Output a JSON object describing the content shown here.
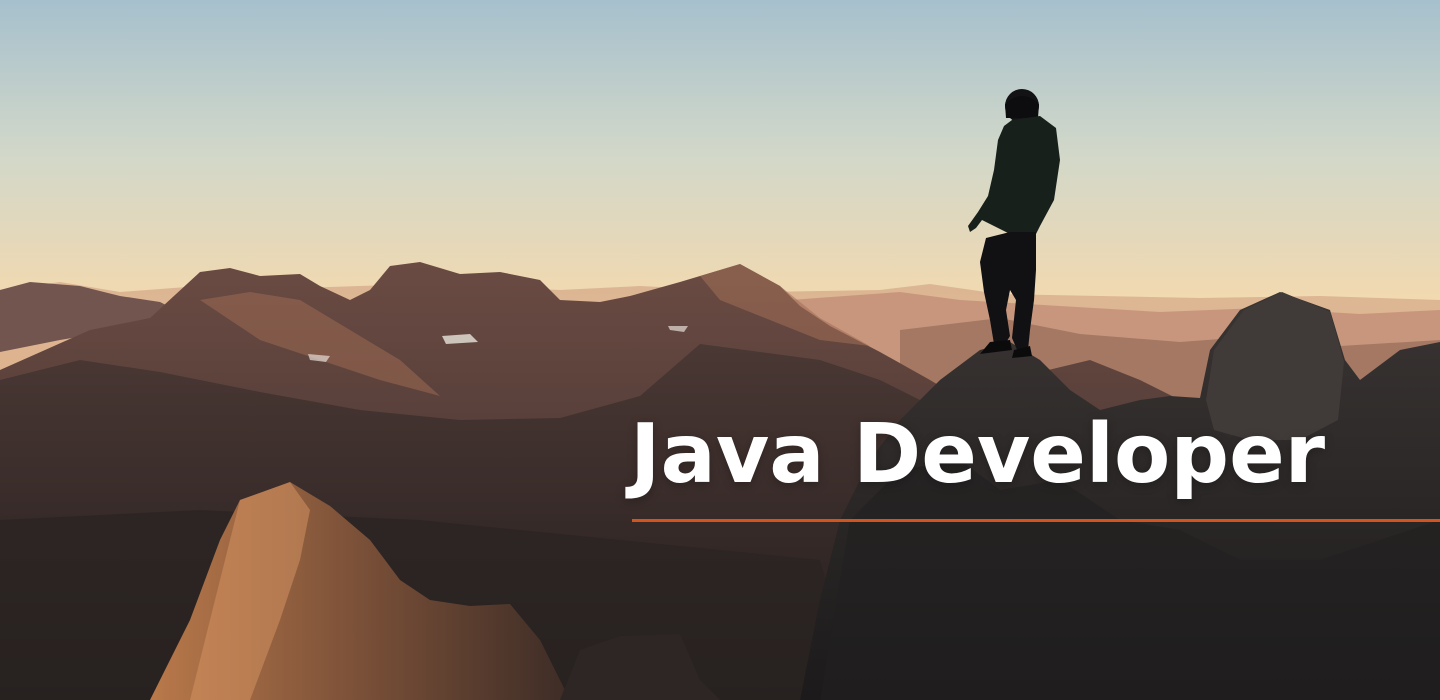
{
  "hero": {
    "title": "Java Developer"
  },
  "colors": {
    "accent": "#d4541e",
    "title": "#ffffff",
    "sky_top": "#a9c2cf",
    "sky_horizon": "#f6c790"
  },
  "scene": {
    "depicts": "silhouette-person-on-mountain-peak-at-sunset"
  }
}
